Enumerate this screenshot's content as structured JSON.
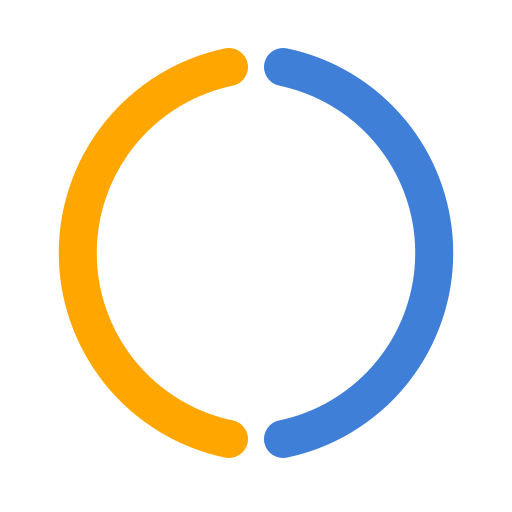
{
  "icon": {
    "name": "split-ring-icon",
    "segments": [
      {
        "name": "left-arc",
        "color": "#FFA600"
      },
      {
        "name": "right-arc",
        "color": "#3F7FD7"
      }
    ]
  }
}
